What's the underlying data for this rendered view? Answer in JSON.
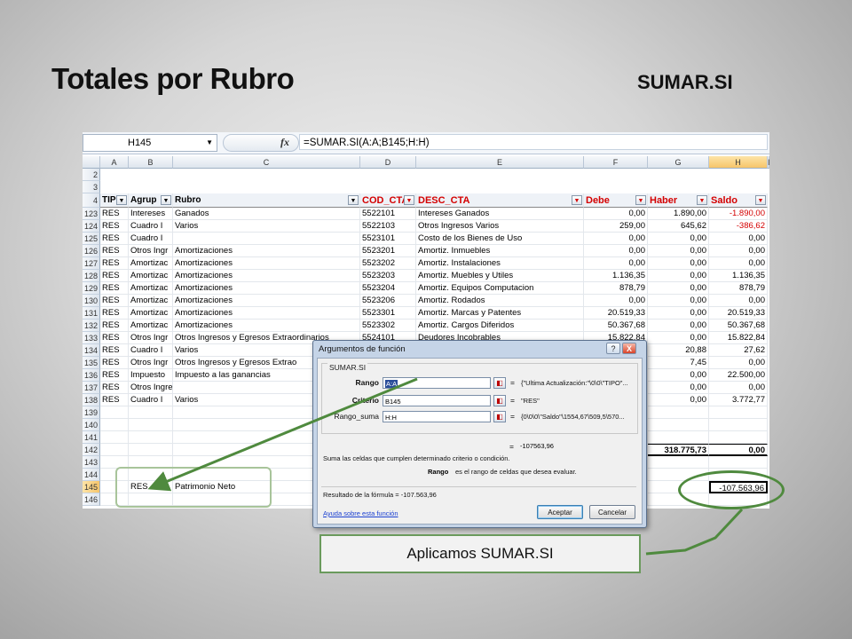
{
  "slide": {
    "title": "Totales por Rubro",
    "function_name": "SUMAR.SI",
    "callout": "Aplicamos SUMAR.SI"
  },
  "formula_bar": {
    "name_box": "H145",
    "fx": "fx",
    "formula": "=SUMAR.SI(A:A;B145;H:H)"
  },
  "columns": [
    "A",
    "B",
    "C",
    "D",
    "E",
    "F",
    "G",
    "H",
    "I"
  ],
  "header_row": {
    "num": "4",
    "cells": [
      "TIP",
      "Agrup",
      "Rubro",
      "COD_CTA",
      "DESC_CTA",
      "Debe",
      "Haber",
      "Saldo"
    ]
  },
  "empty_rows": [
    "2",
    "3"
  ],
  "rows": [
    {
      "n": "123",
      "a": "RES",
      "b": "Intereses",
      "c": "Ganados",
      "d": "5522101",
      "e": "Intereses Ganados",
      "f": "0,00",
      "g": "1.890,00",
      "h": "-1.890,00",
      "neg": true
    },
    {
      "n": "124",
      "a": "RES",
      "b": "Cuadro I",
      "c": "Varios",
      "d": "5522103",
      "e": "Otros Ingresos Varios",
      "f": "259,00",
      "g": "645,62",
      "h": "-386,62",
      "neg": true
    },
    {
      "n": "125",
      "a": "RES",
      "b": "Cuadro I",
      "c": "",
      "d": "5523101",
      "e": "Costo de los Bienes de Uso",
      "f": "0,00",
      "g": "0,00",
      "h": "0,00"
    },
    {
      "n": "126",
      "a": "RES",
      "b": "Otros Ingr",
      "c": "Amortizaciones",
      "d": "5523201",
      "e": "Amortiz. Inmuebles",
      "f": "0,00",
      "g": "0,00",
      "h": "0,00"
    },
    {
      "n": "127",
      "a": "RES",
      "b": "Amortizac",
      "c": "Amortizaciones",
      "d": "5523202",
      "e": "Amortiz. Instalaciones",
      "f": "0,00",
      "g": "0,00",
      "h": "0,00"
    },
    {
      "n": "128",
      "a": "RES",
      "b": "Amortizac",
      "c": "Amortizaciones",
      "d": "5523203",
      "e": "Amortiz. Muebles y Utiles",
      "f": "1.136,35",
      "g": "0,00",
      "h": "1.136,35"
    },
    {
      "n": "129",
      "a": "RES",
      "b": "Amortizac",
      "c": "Amortizaciones",
      "d": "5523204",
      "e": "Amortiz. Equipos Computacion",
      "f": "878,79",
      "g": "0,00",
      "h": "878,79"
    },
    {
      "n": "130",
      "a": "RES",
      "b": "Amortizac",
      "c": "Amortizaciones",
      "d": "5523206",
      "e": "Amortiz. Rodados",
      "f": "0,00",
      "g": "0,00",
      "h": "0,00"
    },
    {
      "n": "131",
      "a": "RES",
      "b": "Amortizac",
      "c": "Amortizaciones",
      "d": "5523301",
      "e": "Amortiz. Marcas y Patentes",
      "f": "20.519,33",
      "g": "0,00",
      "h": "20.519,33"
    },
    {
      "n": "132",
      "a": "RES",
      "b": "Amortizac",
      "c": "Amortizaciones",
      "d": "5523302",
      "e": "Amortiz. Cargos Diferidos",
      "f": "50.367,68",
      "g": "0,00",
      "h": "50.367,68"
    },
    {
      "n": "133",
      "a": "RES",
      "b": "Otros Ingr",
      "c": "Otros Ingresos y Egresos Extraordinarios",
      "d": "5524101",
      "e": "Deudores Incobrables",
      "f": "15.822,84",
      "g": "0,00",
      "h": "15.822,84"
    },
    {
      "n": "134",
      "a": "RES",
      "b": "Cuadro I",
      "c": "Varios",
      "d": "",
      "e": "",
      "f": "",
      "g": "20,88",
      "h": "27,62"
    },
    {
      "n": "135",
      "a": "RES",
      "b": "Otros Ingr",
      "c": "Otros Ingresos y Egresos Extrao",
      "d": "",
      "e": "",
      "f": "",
      "g": "7,45",
      "h": "0,00"
    },
    {
      "n": "136",
      "a": "RES",
      "b": "Impuesto",
      "c": "Impuesto a las ganancias",
      "d": "",
      "e": "",
      "f": "",
      "g": "0,00",
      "h": "22.500,00"
    },
    {
      "n": "137",
      "a": "RES",
      "b": "Otros Ingresos",
      "c": "",
      "d": "",
      "e": "",
      "f": "",
      "g": "0,00",
      "h": "0,00"
    },
    {
      "n": "138",
      "a": "RES",
      "b": "Cuadro I",
      "c": "Varios",
      "d": "",
      "e": "",
      "f": "",
      "g": "0,00",
      "h": "3.772,77"
    },
    {
      "n": "139",
      "a": "",
      "b": "",
      "c": "",
      "d": "",
      "e": "",
      "f": "",
      "g": "",
      "h": ""
    },
    {
      "n": "140",
      "a": "",
      "b": "",
      "c": "",
      "d": "",
      "e": "",
      "f": "",
      "g": "",
      "h": ""
    },
    {
      "n": "141",
      "a": "",
      "b": "",
      "c": "",
      "d": "",
      "e": "",
      "f": "",
      "g": "",
      "h": ""
    },
    {
      "n": "142",
      "a": "",
      "b": "",
      "c": "",
      "d": "",
      "e": "",
      "f": "",
      "g": "318.775,73",
      "h": "0,00",
      "total": true
    },
    {
      "n": "143",
      "a": "",
      "b": "",
      "c": "",
      "d": "",
      "e": "",
      "f": "",
      "g": "",
      "h": ""
    },
    {
      "n": "144",
      "a": "",
      "b": "",
      "c": "",
      "d": "",
      "e": "",
      "f": "",
      "g": "",
      "h": ""
    },
    {
      "n": "145",
      "a": "",
      "b": "RES",
      "c": "Patrimonio Neto",
      "d": "",
      "e": "",
      "f": "",
      "g": "",
      "h": "-107.563,96",
      "active": true
    },
    {
      "n": "146",
      "a": "",
      "b": "",
      "c": "",
      "d": "",
      "e": "",
      "f": "",
      "g": "",
      "h": ""
    }
  ],
  "dialog": {
    "title": "Argumentos de función",
    "help_btn": "?",
    "close_btn": "X",
    "group": "SUMAR.SI",
    "args": [
      {
        "label": "Rango",
        "input": "A:A",
        "value": "{\"Ultima Actualización:\"\\0\\0\\\"TIPO\"..."
      },
      {
        "label": "Criterio",
        "input": "B145",
        "value": "\"RES\""
      },
      {
        "label": "Rango_suma",
        "input": "H:H",
        "value": "{0\\0\\0\\\"Saldo\"\\1554,67\\509,5\\570..."
      }
    ],
    "eq": "=",
    "result": "-107563,96",
    "description": "Suma las celdas que cumplen determinado criterio o condición.",
    "arg_name": "Rango",
    "arg_desc": "es el rango de celdas que desea evaluar.",
    "formula_result": "Resultado de la fórmula = -107.563,96",
    "help_link": "Ayuda sobre esta función",
    "ok": "Aceptar",
    "cancel": "Cancelar"
  }
}
